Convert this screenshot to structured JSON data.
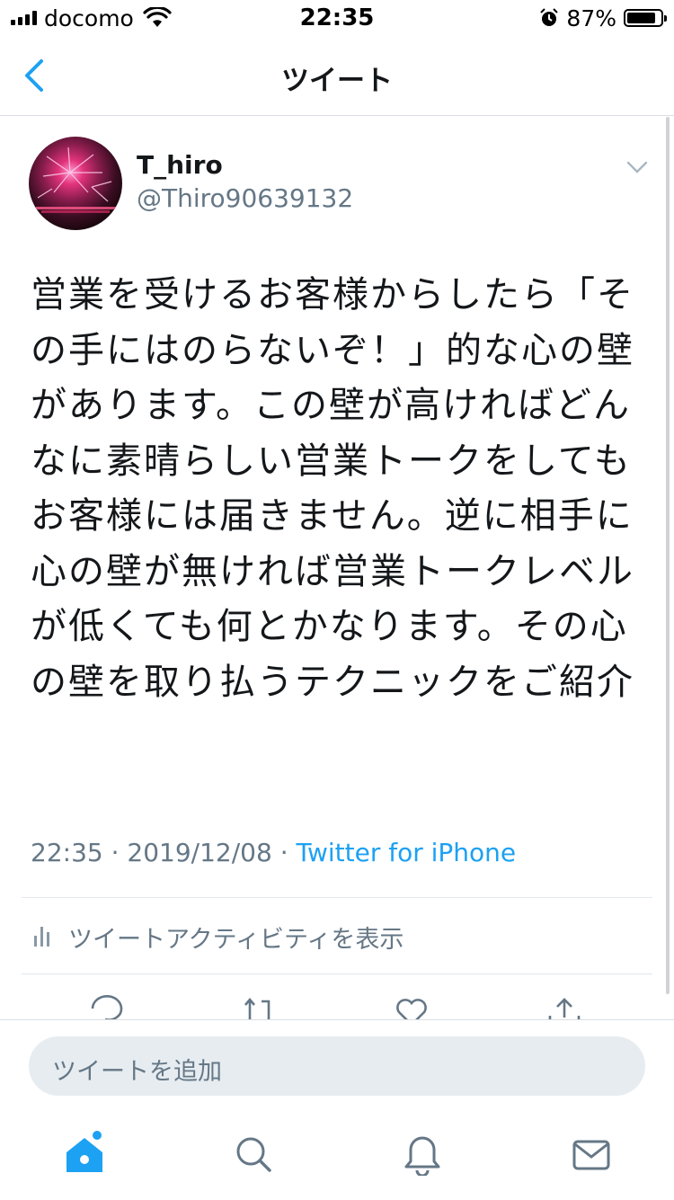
{
  "status_bar": {
    "carrier": "docomo",
    "time": "22:35",
    "battery": "87%",
    "battery_level": 0.87
  },
  "nav": {
    "title": "ツイート"
  },
  "tweet": {
    "display_name": "T_hiro",
    "handle": "@Thiro90639132",
    "text": "営業を受けるお客様からしたら「その手にはのらないぞ！」的な心の壁があります。この壁が高ければどんなに素晴らしい営業トークをしてもお客様には届きません。逆に相手に心の壁が無ければ営業トークレベルが低くても何とかなります。その心の壁を取り払うテクニックをご紹介",
    "time": "22:35",
    "date": "2019/12/08",
    "separator": " · ",
    "source": "Twitter for iPhone"
  },
  "activity": {
    "label": "ツイートアクティビティを表示"
  },
  "composer": {
    "placeholder": "ツイートを追加"
  },
  "colors": {
    "accent": "#1da1f2",
    "secondary_text": "#657786"
  }
}
